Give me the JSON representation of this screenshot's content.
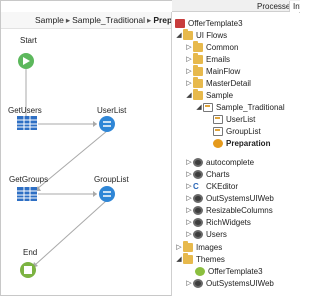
{
  "tabs": {
    "processes": "Processes",
    "interface_cut": "Int"
  },
  "breadcrumb": {
    "part1": "Sample",
    "part2": "Sample_Traditional",
    "current": "Preparation"
  },
  "flow_nodes": {
    "start": "Start",
    "get_users": "GetUsers",
    "user_list": "UserList",
    "get_groups": "GetGroups",
    "group_list": "GroupList",
    "end": "End"
  },
  "tree": {
    "root": "OfferTemplate3",
    "ui_flows": "UI Flows",
    "common": "Common",
    "emails": "Emails",
    "main_flow": "MainFlow",
    "master_detail": "MasterDetail",
    "sample": "Sample",
    "sample_traditional": "Sample_Traditional",
    "user_list": "UserList",
    "group_list": "GroupList",
    "preparation": "Preparation",
    "autocomplete": "autocomplete",
    "charts": "Charts",
    "ckeditor": "CKEditor",
    "outsystems_ui_web": "OutSystemsUIWeb",
    "resizable_columns": "ResizableColumns",
    "rich_widgets": "RichWidgets",
    "users": "Users",
    "images": "Images",
    "themes": "Themes",
    "theme_offer": "OfferTemplate3",
    "theme_outsystems": "OutSystemsUIWeb"
  },
  "colors": {
    "start_green": "#5cb85c",
    "action_blue": "#2e6fc4",
    "end_green": "#7cb342",
    "list_blue": "#2f86d6"
  }
}
